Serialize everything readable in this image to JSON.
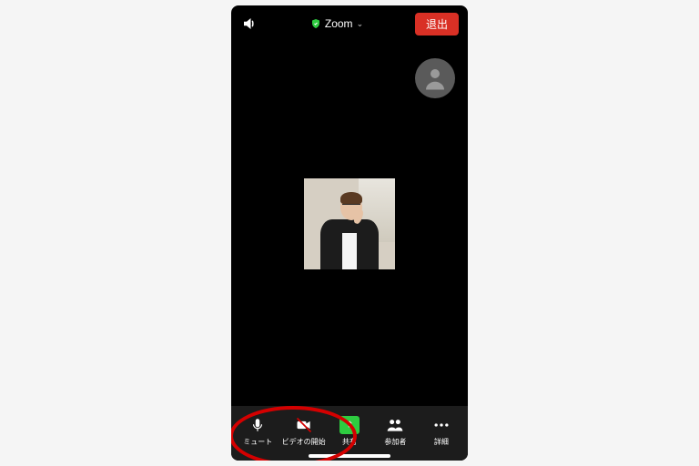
{
  "header": {
    "app_title": "Zoom",
    "exit_label": "退出"
  },
  "bottom": {
    "mute_label": "ミュート",
    "video_label": "ビデオの開始",
    "share_label": "共有",
    "participants_label": "参加者",
    "more_label": "詳細"
  },
  "colors": {
    "exit_bg": "#d93025",
    "share_bg": "#2ecc40",
    "annotation": "#d40000"
  }
}
